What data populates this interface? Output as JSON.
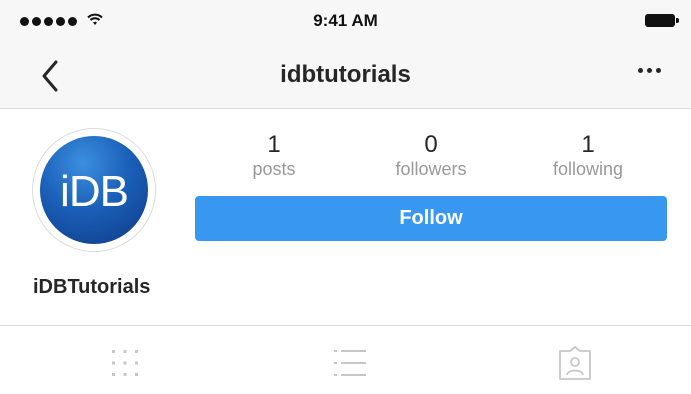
{
  "status_bar": {
    "time": "9:41 AM",
    "signal_icon": "signal-dots-icon",
    "wifi_icon": "wifi-icon",
    "battery_icon": "battery-icon"
  },
  "nav": {
    "back_icon": "chevron-left-icon",
    "title": "idbtutorials",
    "more_icon": "more-horizontal-icon"
  },
  "profile": {
    "avatar_text": "iDB",
    "display_name": "iDBTutorials",
    "stats": [
      {
        "value": "1",
        "label": "posts"
      },
      {
        "value": "0",
        "label": "followers"
      },
      {
        "value": "1",
        "label": "following"
      }
    ],
    "follow_label": "Follow"
  },
  "tabs": [
    {
      "icon": "grid-icon"
    },
    {
      "icon": "list-icon"
    },
    {
      "icon": "tagged-person-icon"
    }
  ],
  "colors": {
    "accent": "#3897f0",
    "header_bg": "#f7f7f7",
    "muted_text": "#999999",
    "icon_gray": "#c7c7c7"
  }
}
